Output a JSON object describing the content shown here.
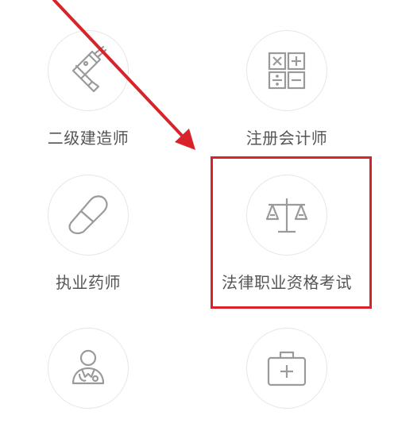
{
  "tiles": [
    {
      "label": "二级建造师",
      "icon": "drill-icon"
    },
    {
      "label": "注册会计师",
      "icon": "calculator-icon"
    },
    {
      "label": "执业药师",
      "icon": "pill-capsule-icon"
    },
    {
      "label": "法律职业资格考试",
      "icon": "scale-icon"
    },
    {
      "label": "",
      "icon": "doctor-icon"
    },
    {
      "label": "",
      "icon": "medical-kit-icon"
    }
  ],
  "colors": {
    "icon_stroke": "#9a9a9a",
    "circle_border": "#e6e6e6",
    "label_text": "#555555",
    "highlight": "#d8232a",
    "arrow": "#d8232a"
  }
}
